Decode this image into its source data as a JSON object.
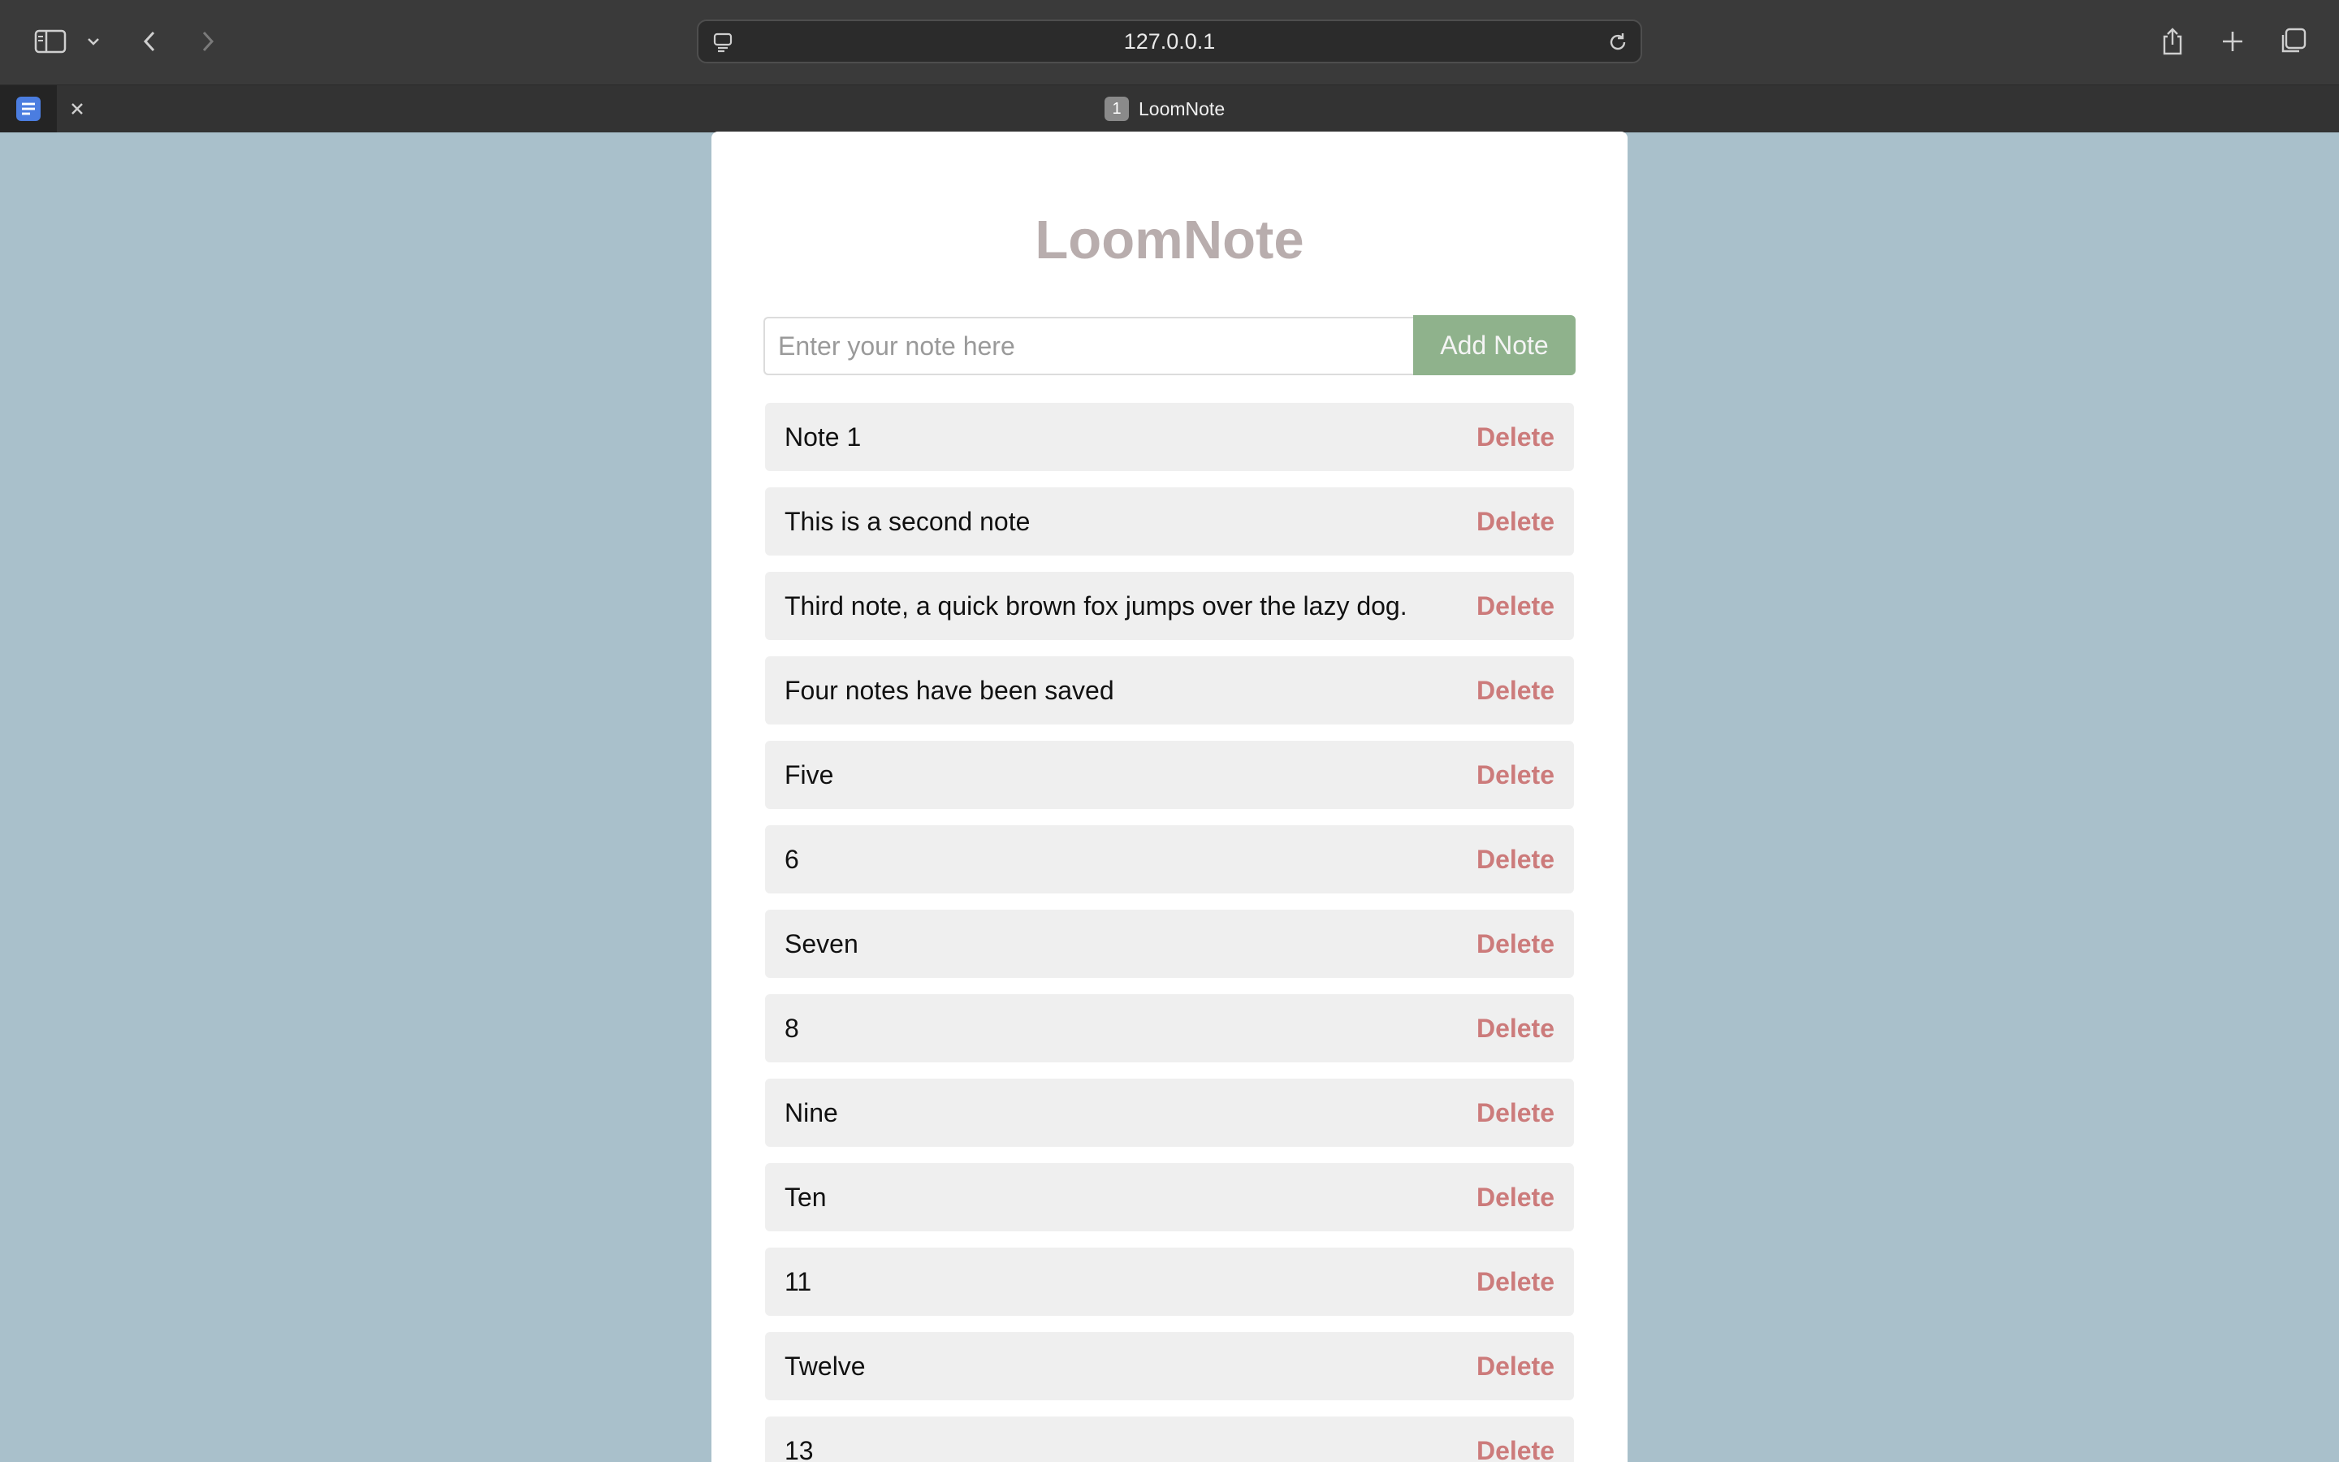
{
  "browser": {
    "address": "127.0.0.1",
    "tab_number": "1",
    "tab_title": "LoomNote",
    "icons": [
      "sidebar-icon",
      "chevron-down-icon",
      "back-icon",
      "forward-icon",
      "reader-icon",
      "reload-icon",
      "share-icon",
      "new-tab-icon",
      "tab-overview-icon",
      "close-icon"
    ]
  },
  "app": {
    "title": "LoomNote",
    "input_placeholder": "Enter your note here",
    "add_label": "Add Note",
    "delete_label": "Delete",
    "colors": {
      "background": "#a9c0cb",
      "title": "#b8adad",
      "add_button": "#8fb28c",
      "delete": "#cc7b7b",
      "note_bg": "#efefef"
    },
    "notes": [
      "Note 1",
      "This is a second note",
      "Third note, a quick brown fox jumps over the lazy dog.",
      "Four notes have been saved",
      "Five",
      "6",
      "Seven",
      "8",
      "Nine",
      "Ten",
      "11",
      "Twelve",
      "13"
    ]
  }
}
